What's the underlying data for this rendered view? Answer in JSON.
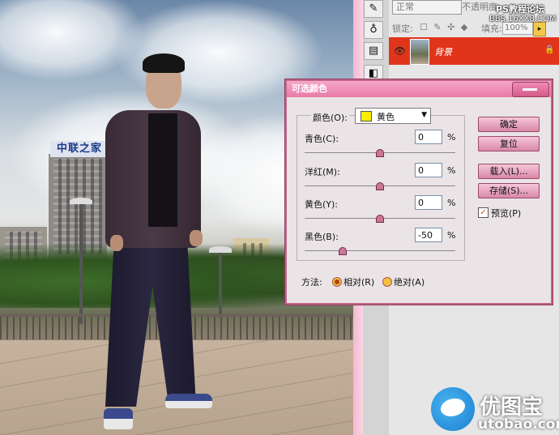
{
  "panel": {
    "blend_mode": "正常",
    "opacity_label": "不透明度",
    "lock_label": "锁定:",
    "fill_label": "填充:",
    "fill_value": "100%",
    "layer_name": "背景"
  },
  "watermark": {
    "top": "PS教程论坛",
    "url": "BBS.16XX8.COM",
    "logo_text": "优图宝",
    "logo_url": "utobao.com"
  },
  "photo": {
    "sign_text": "中联之家"
  },
  "dialog": {
    "title": "可选颜色",
    "color_label": "颜色(O):",
    "color_value": "黄色",
    "color_swatch": "#ffee00",
    "sliders": [
      {
        "label": "青色(C):",
        "value": "0",
        "unit": "%",
        "position": 0.5
      },
      {
        "label": "洋红(M):",
        "value": "0",
        "unit": "%",
        "position": 0.5
      },
      {
        "label": "黄色(Y):",
        "value": "0",
        "unit": "%",
        "position": 0.5
      },
      {
        "label": "黑色(B):",
        "value": "-50",
        "unit": "%",
        "position": 0.25
      }
    ],
    "buttons": {
      "ok": "确定",
      "reset": "复位",
      "load": "载入(L)...",
      "save": "存储(S)..."
    },
    "preview_label": "预览(P)",
    "preview_checked": true,
    "method_label": "方法:",
    "method_relative": "相对(R)",
    "method_absolute": "绝对(A)",
    "method_selected": "relative"
  }
}
